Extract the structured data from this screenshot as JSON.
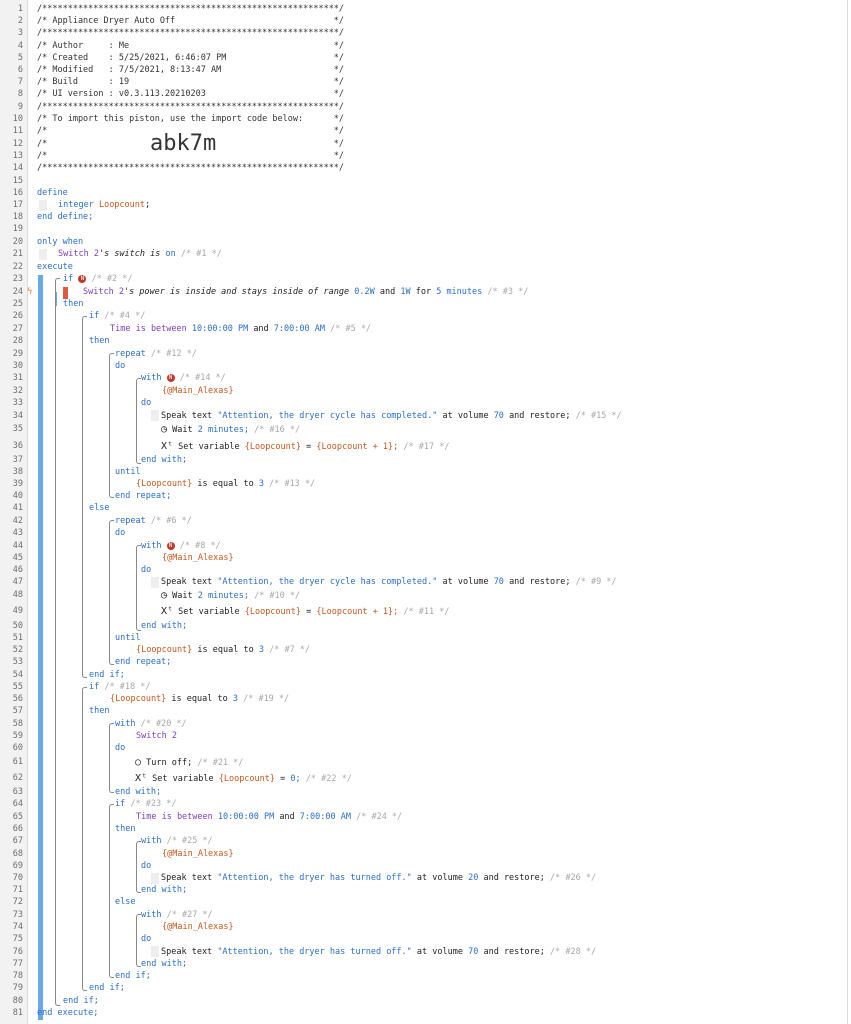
{
  "piston": {
    "lines": [
      {
        "n": "1",
        "t": "/**********************************************************/"
      },
      {
        "n": "2",
        "t": "/* Appliance Dryer Auto Off                               */"
      },
      {
        "n": "3",
        "t": "/**********************************************************/"
      },
      {
        "n": "4",
        "t": "/* Author     : Me                                        */"
      },
      {
        "n": "5",
        "t": "/* Created    : 5/25/2021, 6:46:07 PM                     */"
      },
      {
        "n": "6",
        "t": "/* Modified   : 7/5/2021, 8:13:47 AM                      */"
      },
      {
        "n": "7",
        "t": "/* Build      : 19                                        */"
      },
      {
        "n": "8",
        "t": "/* UI version : v0.3.113.20210203                         */"
      },
      {
        "n": "9",
        "t": "/**********************************************************/"
      },
      {
        "n": "10",
        "t": "/* To import this piston, use the import code below:      */"
      },
      {
        "n": "11",
        "t": "/*                                                        */"
      },
      {
        "n": "12",
        "t": "/*                                                        */"
      },
      {
        "n": "13",
        "t": "/*                                                        */"
      },
      {
        "n": "14",
        "t": "/**********************************************************/"
      }
    ],
    "import_code": "abk7m"
  },
  "gutter": [
    "1",
    "2",
    "3",
    "4",
    "5",
    "6",
    "7",
    "8",
    "9",
    "10",
    "11",
    "12",
    "13",
    "14",
    "15",
    "16",
    "17",
    "18",
    "19",
    "20",
    "21",
    "22",
    "23",
    "24",
    "25",
    "26",
    "27",
    "28",
    "29",
    "30",
    "31",
    "32",
    "33",
    "34",
    "35",
    "36",
    "37",
    "38",
    "39",
    "40",
    "41",
    "42",
    "43",
    "44",
    "45",
    "46",
    "47",
    "48",
    "49",
    "50",
    "51",
    "52",
    "53",
    "54",
    "55",
    "56",
    "57",
    "58",
    "59",
    "60",
    "61",
    "62",
    "63",
    "64",
    "65",
    "66",
    "67",
    "68",
    "69",
    "70",
    "71",
    "72",
    "73",
    "74",
    "75",
    "76",
    "77",
    "78",
    "79",
    "80",
    "81"
  ],
  "code": {
    "define": "define",
    "integer": "integer",
    "loopcount_var": "Loopcount",
    "semicolon": ";",
    "end_define": "end define;",
    "only_when": "only when",
    "switch2": "Switch 2",
    "switch_attr": "'s switch is",
    "on": "on",
    "c1": "/* #1 */",
    "execute": "execute",
    "if": "if",
    "c2": "/* #2 */",
    "power_attr": "'s power is inside and stays inside of range",
    "r_low": "0.2W",
    "and": "and",
    "r_high": "1W",
    "for": "for",
    "duration": "5 minutes",
    "c3": "/* #3 */",
    "then": "then",
    "c4": "/* #4 */",
    "time_between": "Time is between",
    "t_start": "10:00:00 PM",
    "t_end": "7:00:00 AM",
    "c5": "/* #5 */",
    "repeat": "repeat",
    "c12": "/* #12 */",
    "do": "do",
    "with": "with",
    "c14": "/* #14 */",
    "main_alexas": "{@Main_Alexas}",
    "speak_text": "Speak text",
    "msg_completed": "\"Attention, the dryer cycle has completed.\"",
    "at_volume": "at volume",
    "vol70": "70",
    "and_restore": "and restore;",
    "c15": "/* #15 */",
    "wait": "Wait",
    "wait_dur": "2 minutes;",
    "c16": "/* #16 */",
    "set_variable": "Set variable",
    "loopcount_braced": "{Loopcount}",
    "eq": "=",
    "inc_expr": "{Loopcount + 1};",
    "c17": "/* #17 */",
    "end_with": "end with;",
    "until": "until",
    "is_equal_to": "is equal to",
    "three": "3",
    "c13": "/* #13 */",
    "end_repeat": "end repeat;",
    "else": "else",
    "c6": "/* #6 */",
    "c8": "/* #8 */",
    "c9": "/* #9 */",
    "c10": "/* #10 */",
    "c11": "/* #11 */",
    "c7": "/* #7 */",
    "end_if": "end if;",
    "c18": "/* #18 */",
    "c19": "/* #19 */",
    "c20": "/* #20 */",
    "turn_off": "Turn off;",
    "c21": "/* #21 */",
    "zero": "0;",
    "c22": "/* #22 */",
    "c23": "/* #23 */",
    "c24": "/* #24 */",
    "c25": "/* #25 */",
    "msg_off": "\"Attention, the dryer has turned off.\"",
    "vol20": "20",
    "c26": "/* #26 */",
    "c27": "/* #27 */",
    "c28": "/* #28 */",
    "end_execute": "end execute;"
  },
  "colors": {
    "keyword": "#2a6fc9",
    "device": "#7d3fc0",
    "variable": "#c6581f",
    "comment": "#a8a8a8",
    "rail": "#69a8ea",
    "badge": "#c0392b",
    "active_bar": "#e05a43"
  },
  "icons": {
    "cond_badge": "N",
    "clock": "clock-icon",
    "set_var": "variable-icon",
    "power": "power-icon",
    "bolt": "bolt-icon"
  }
}
